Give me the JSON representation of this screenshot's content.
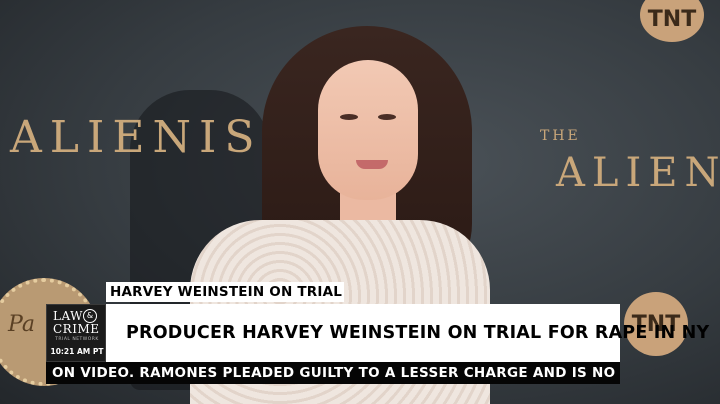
{
  "backdrop": {
    "left_text": "ALIENIST",
    "right_small": "THE",
    "right_text": "ALIENIST",
    "network_bug": "TNT",
    "sponsor_text": "Pa"
  },
  "chyron": {
    "kicker": "HARVEY WEINSTEIN ON TRIAL",
    "headline": "PRODUCER HARVEY WEINSTEIN ON TRIAL FOR RAPE IN NY",
    "ticker": "ON VIDEO.  RAMONES PLEADED GUILTY TO A LESSER CHARGE AND IS NO LONG"
  },
  "network": {
    "line1": "LAW",
    "amp": "&",
    "line2": "CRIME",
    "tagline": "TRIAL NETWORK",
    "time": "10:21 AM PT"
  },
  "colors": {
    "gold": "#c9a77a",
    "chyron_bg": "#ffffff",
    "ticker_bg": "#050505"
  }
}
